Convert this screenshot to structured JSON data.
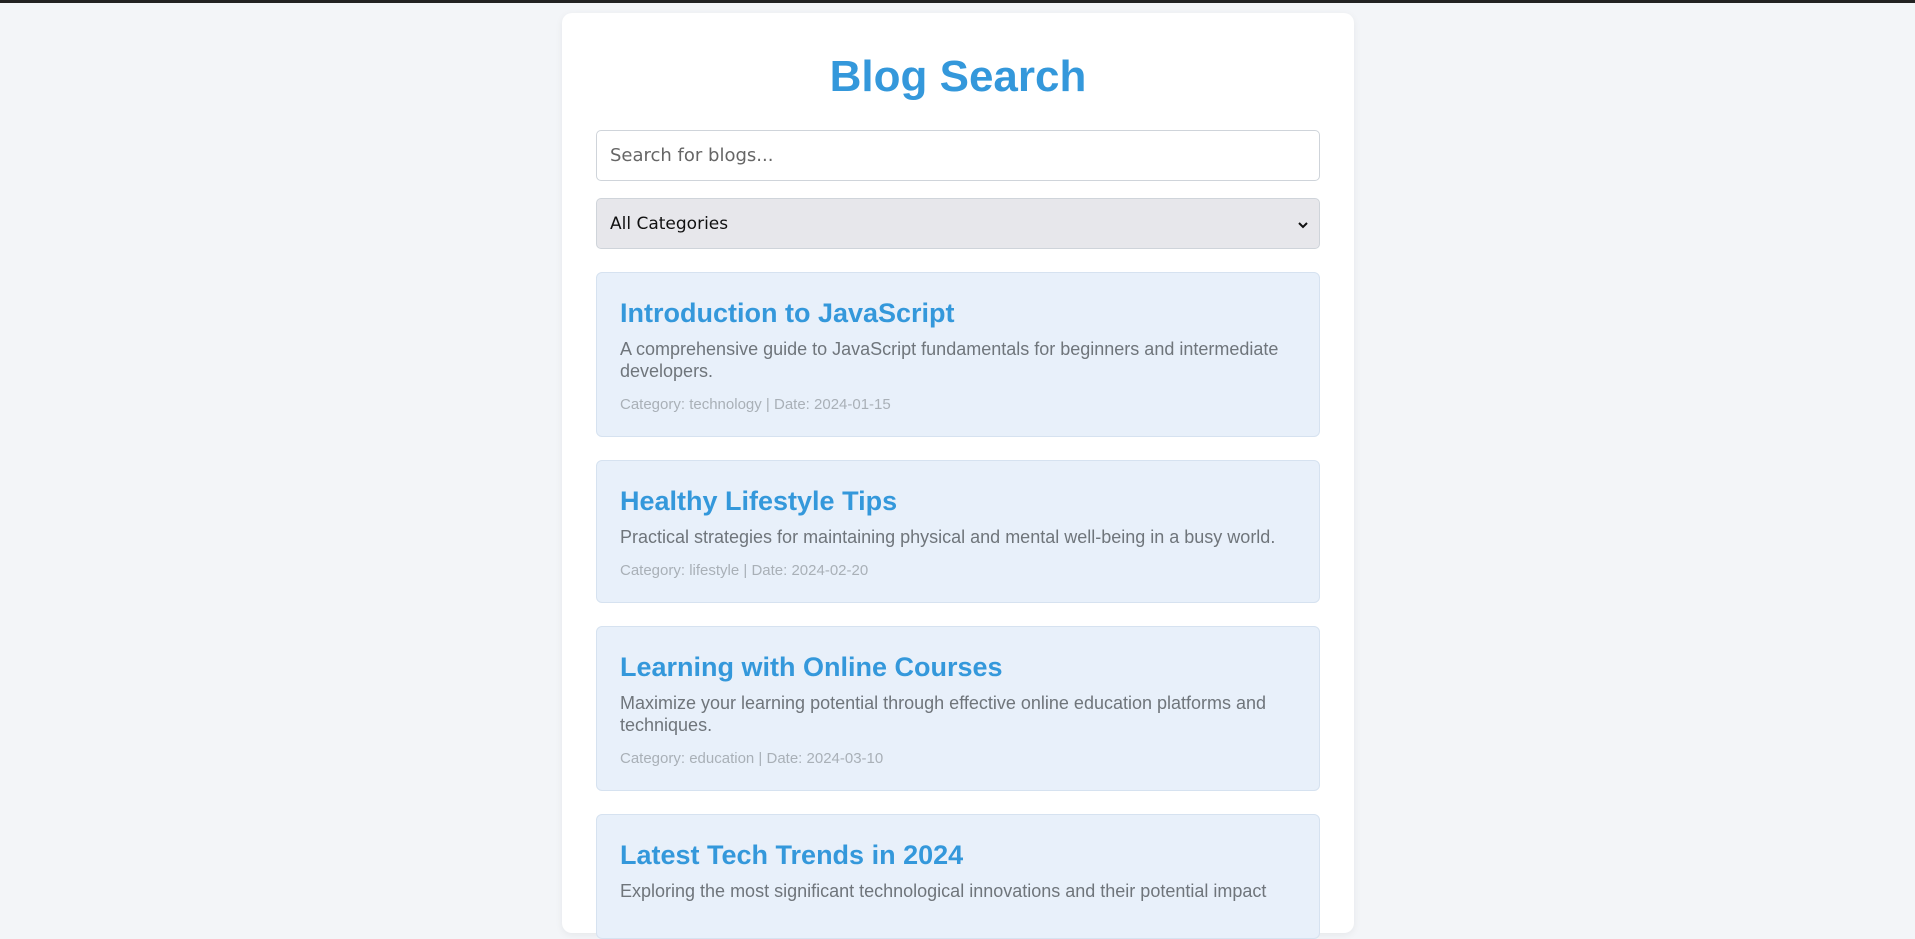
{
  "page": {
    "title": "Blog Search"
  },
  "search": {
    "placeholder": "Search for blogs...",
    "value": ""
  },
  "category_filter": {
    "selected": "All Categories"
  },
  "blogs": [
    {
      "title": "Introduction to JavaScript",
      "description": "A comprehensive guide to JavaScript fundamentals for beginners and intermediate developers.",
      "meta": "Category: technology | Date: 2024-01-15"
    },
    {
      "title": "Healthy Lifestyle Tips",
      "description": "Practical strategies for maintaining physical and mental well-being in a busy world.",
      "meta": "Category: lifestyle | Date: 2024-02-20"
    },
    {
      "title": "Learning with Online Courses",
      "description": "Maximize your learning potential through effective online education platforms and techniques.",
      "meta": "Category: education | Date: 2024-03-10"
    },
    {
      "title": "Latest Tech Trends in 2024",
      "description": "Exploring the most significant technological innovations and their potential impact",
      "meta": ""
    }
  ],
  "colors": {
    "accent": "#3498db",
    "card_bg": "#e8f0fa",
    "page_bg": "#f3f5f8"
  }
}
